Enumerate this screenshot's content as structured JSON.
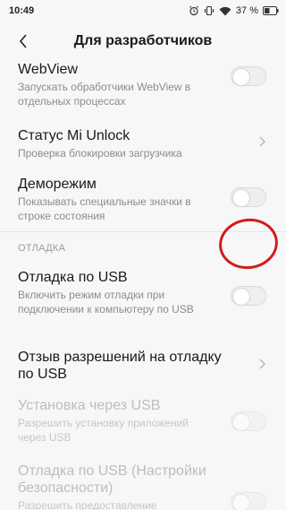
{
  "status": {
    "time": "10:49",
    "battery": "37 %"
  },
  "header": {
    "title": "Для разработчиков"
  },
  "items": [
    {
      "title": "WebView",
      "subtitle": "Запускать обработчики WebView в отдельных процессах"
    },
    {
      "title": "Статус Mi Unlock",
      "subtitle": "Проверка блокировки загрузчика"
    },
    {
      "title": "Деморежим",
      "subtitle": "Показывать специальные значки в строке состояния"
    },
    {
      "title": "Отладка по USB",
      "subtitle": "Включить режим отладки при подключении к компьютеру по USB"
    },
    {
      "title": "Отзыв разрешений на отладку по USB"
    },
    {
      "title": "Установка через USB",
      "subtitle": "Разрешить установку приложений через USB"
    },
    {
      "title": "Отладка по USB (Настройки безопасности)",
      "subtitle": "Разрешить предоставление"
    }
  ],
  "sections": {
    "debug": "ОТЛАДКА"
  },
  "colors": {
    "highlight": "#d31b1b",
    "background": "#f7f7f7"
  }
}
